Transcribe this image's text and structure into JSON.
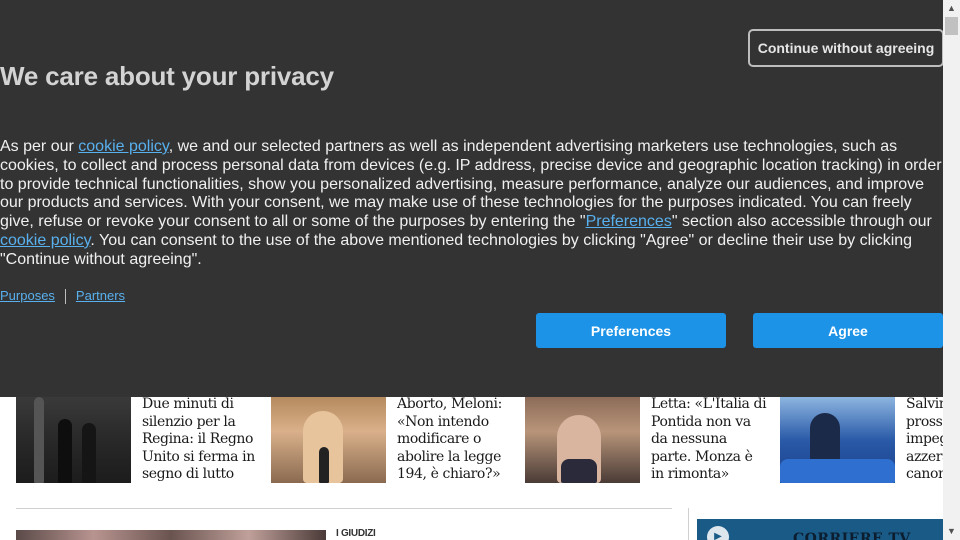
{
  "consent": {
    "continue_label": "Continue without agreeing",
    "title": "We care about your privacy",
    "body": {
      "p1": "As per our ",
      "link_cookie_policy": "cookie policy",
      "p2": ", we and our selected partners as well as independent advertising marketers use technologies, such as cookies, to collect and process personal data from devices (e.g. IP address, precise device and geographic location tracking) in order to provide technical functionalities, show you personalized advertising, measure performance, analyze our audiences, and improve our products and services. With your consent, we may make use of these technologies for the purposes indicated. You can freely give, refuse or revoke your consent to all or some of the purposes by entering the \"",
      "link_preferences": "Preferences",
      "p3": "\" section also accessible through our ",
      "link_cookie_policy_2": "cookie policy",
      "p4": ". You can consent to the use of the above mentioned technologies by clicking \"Agree\" or decline their use by clicking \"Continue without agreeing\"."
    },
    "links": {
      "purposes": "Purposes",
      "partners": "Partners"
    },
    "preferences_label": "Preferences",
    "agree_label": "Agree",
    "colors": {
      "background": "#333333",
      "accent": "#1c93e6",
      "link": "#58b0ee"
    }
  },
  "news": [
    {
      "title": "Due minuti di silenzio per la Regina: il Regno Unito si ferma in segno di lutto"
    },
    {
      "title": "Aborto, Meloni: «Non intendo modificare o abolire la legge 194, è chiaro?»"
    },
    {
      "title": "Letta: «L'Italia di Pontida non va da nessuna parte. Monza è in rimonta»"
    },
    {
      "title": "Salvini: «Nei prossimi giorni impegno ad azzerare il canone»"
    }
  ],
  "section_label": "I GIUDIZI",
  "corriere_tv": {
    "label": "CORRIERE TV",
    "icon": "play-icon"
  },
  "scrollbar": {
    "up_icon": "arrow-up-icon",
    "down_icon": "arrow-down-icon"
  }
}
